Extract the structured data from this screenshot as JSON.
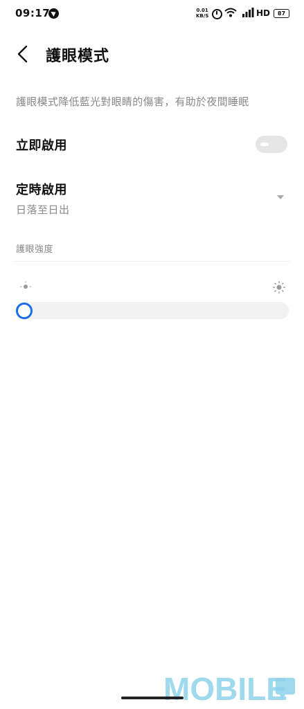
{
  "status_bar": {
    "time": "09:17",
    "net_speed_value": "0.01",
    "net_speed_unit": "KB/S",
    "network_type": "HD",
    "battery": "87",
    "icons": [
      "app-notification-icon",
      "alarm-icon",
      "wifi-icon",
      "signal-icon",
      "battery-icon"
    ]
  },
  "header": {
    "title": "護眼模式",
    "back_icon": "chevron-left-icon"
  },
  "description": "護眼模式降低藍光對眼睛的傷害，有助於夜間睡眠",
  "instant": {
    "label": "立即啟用",
    "enabled": false
  },
  "schedule": {
    "label": "定時啟用",
    "value": "日落至日出",
    "icon": "dropdown-arrow-icon"
  },
  "intensity": {
    "header": "護眼強度",
    "level": 0,
    "min_icon": "sun-small-icon",
    "max_icon": "sun-large-icon",
    "accent": "#1a6fe8"
  },
  "watermark": "MOBILE"
}
